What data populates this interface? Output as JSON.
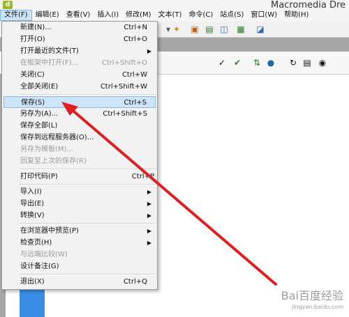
{
  "window": {
    "title": "Macromedia Dre"
  },
  "menubar": [
    {
      "label": "文件(F)",
      "active": true
    },
    {
      "label": "编辑(E)"
    },
    {
      "label": "查看(V)"
    },
    {
      "label": "插入(I)"
    },
    {
      "label": "修改(M)"
    },
    {
      "label": "文本(T)"
    },
    {
      "label": "命令(C)"
    },
    {
      "label": "站点(S)"
    },
    {
      "label": "窗口(W)"
    },
    {
      "label": "帮助(H)"
    }
  ],
  "file_menu": {
    "items": [
      {
        "label": "新建(N)...",
        "shortcut": "Ctrl+N"
      },
      {
        "label": "打开(O)",
        "shortcut": "Ctrl+O"
      },
      {
        "label": "打开最近的文件(T)",
        "submenu": true
      },
      {
        "label": "在框架中打开(F)...",
        "shortcut": "Ctrl+Shift+O",
        "disabled": true
      },
      {
        "label": "关闭(C)",
        "shortcut": "Ctrl+W"
      },
      {
        "label": "全部关闭(E)",
        "shortcut": "Ctrl+Shift+W"
      },
      {
        "label": "保存(S)",
        "shortcut": "Ctrl+S",
        "selected": true
      },
      {
        "label": "另存为(A)...",
        "shortcut": "Ctrl+Shift+S"
      },
      {
        "label": "保存全部(L)"
      },
      {
        "label": "保存到远程服务器(O)..."
      },
      {
        "label": "另存为模板(M)...",
        "disabled": true
      },
      {
        "label": "回复至上次的保存(R)",
        "disabled": true
      },
      {
        "label": "打印代码(P)",
        "shortcut": "Ctrl+P"
      },
      {
        "label": "导入(I)",
        "submenu": true
      },
      {
        "label": "导出(E)",
        "submenu": true
      },
      {
        "label": "转换(V)",
        "submenu": true
      },
      {
        "label": "在浏览器中预览(P)",
        "submenu": true
      },
      {
        "label": "检查页(H)",
        "submenu": true
      },
      {
        "label": "与远端比较(W)",
        "disabled": true
      },
      {
        "label": "设计备注(G)"
      },
      {
        "label": "退出(X)",
        "shortcut": "Ctrl+Q"
      }
    ]
  },
  "watermark": {
    "line1": "Bai百度经验",
    "line2": "jingyan.baidu.com"
  },
  "colors": {
    "arrow": "#e02020",
    "selection": "#cfe3f7",
    "blue_bar": "#3a8ee6"
  },
  "icons": [
    "app-logo-icon",
    "toolbar-icons",
    "submenu-arrow-icon"
  ]
}
